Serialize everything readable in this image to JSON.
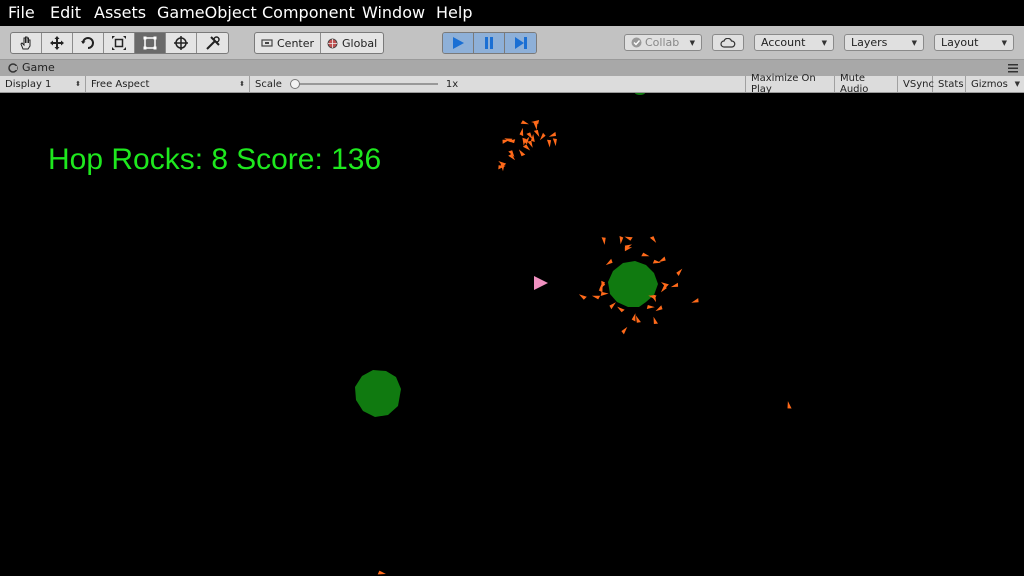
{
  "menubar": {
    "items": [
      "File",
      "Edit",
      "Assets",
      "GameObject",
      "Component",
      "Window",
      "Help"
    ]
  },
  "toolbar": {
    "transform_tools": [
      "hand-tool",
      "move-tool",
      "rotate-tool",
      "scale-tool",
      "rect-tool",
      "transform-tool",
      "custom-tool"
    ],
    "pivot_label": "Center",
    "space_label": "Global",
    "collab_label": "Collab",
    "account_label": "Account",
    "layers_label": "Layers",
    "layout_label": "Layout",
    "play_color": "#1a6fd4"
  },
  "game_tab": {
    "title": "Game"
  },
  "game_bar": {
    "display": "Display 1",
    "aspect": "Free Aspect",
    "scale_label": "Scale",
    "scale_value": "1x",
    "scale_level": 0,
    "maximize": "Maximize On Play",
    "mute": "Mute Audio",
    "vsync": "VSync",
    "stats": "Stats",
    "gizmos": "Gizmos"
  },
  "hud": {
    "label": "Hop Rocks: 8",
    "score": "Score: 136",
    "color": "#1ee81e"
  },
  "scene": {
    "rock_color": "#107a10",
    "ship_color": "#f090c0",
    "debris_color": "#ff6a1a"
  }
}
